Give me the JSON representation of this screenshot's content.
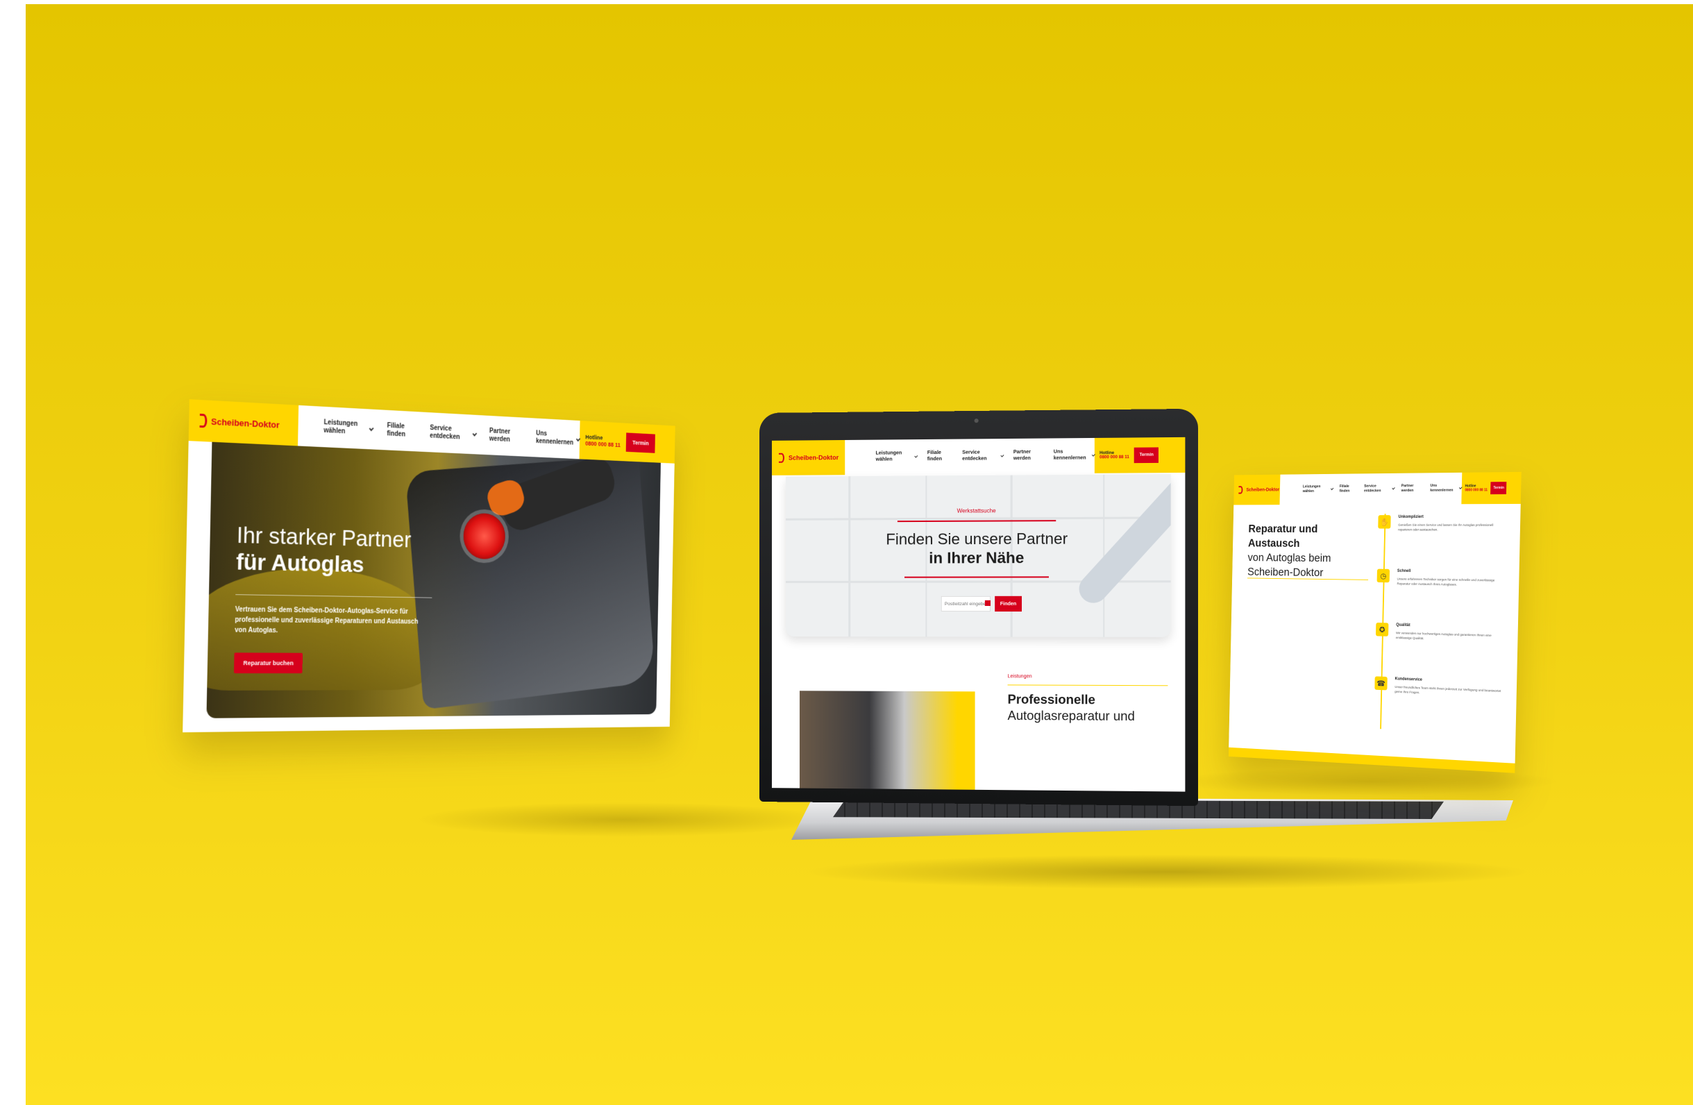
{
  "brand": {
    "name": "Scheiben-Doktor",
    "accent": "#ffd600",
    "red": "#d6001c"
  },
  "nav": {
    "items": [
      {
        "label": "Leistungen wählen",
        "dropdown": true
      },
      {
        "label": "Filiale finden",
        "dropdown": false
      },
      {
        "label": "Service entdecken",
        "dropdown": true
      },
      {
        "label": "Partner werden",
        "dropdown": false
      },
      {
        "label": "Uns kennenlernen",
        "dropdown": true
      }
    ],
    "hotline_label": "Hotline",
    "hotline_number": "0800 000 88 11",
    "termin_label": "Termin"
  },
  "hero": {
    "title_line1": "Ihr starker Partner",
    "title_line2": "für Autoglas",
    "text": "Vertrauen Sie dem Scheiben-Doktor-Autoglas-Service für professionelle und zuverlässige Reparaturen und Austausch von Autoglas.",
    "button": "Reparatur buchen"
  },
  "finder": {
    "kicker": "Werkstattsuche",
    "title_line1": "Finden Sie unsere Partner",
    "title_line2": "in Ihrer Nähe",
    "placeholder": "Postleitzahl eingeben",
    "button": "Finden"
  },
  "services": {
    "kicker": "Leistungen",
    "title_line1": "Professionelle",
    "title_line2": "Autoglasreparatur und"
  },
  "about": {
    "title_line1": "Reparatur und Austausch",
    "title_line2": "von Autoglas beim",
    "title_line3": "Scheiben-Doktor",
    "features": [
      {
        "icon": "handshake-icon",
        "title": "Unkompliziert",
        "text": "Genießen Sie einen Service und lassen Sie Ihr Autoglas professionell reparieren oder austauschen."
      },
      {
        "icon": "clock-icon",
        "title": "Schnell",
        "text": "Unsere erfahrenen Techniker sorgen für eine schnelle und zuverlässige Reparatur oder Austausch Ihres Autoglases."
      },
      {
        "icon": "badge-icon",
        "title": "Qualität",
        "text": "Wir verwenden nur hochwertiges Autoglas und garantieren Ihnen eine erstklassige Qualität."
      },
      {
        "icon": "headset-icon",
        "title": "Kundenservice",
        "text": "Unser freundliches Team steht Ihnen jederzeit zur Verfügung und beantwortet gerne Ihre Fragen."
      }
    ]
  }
}
